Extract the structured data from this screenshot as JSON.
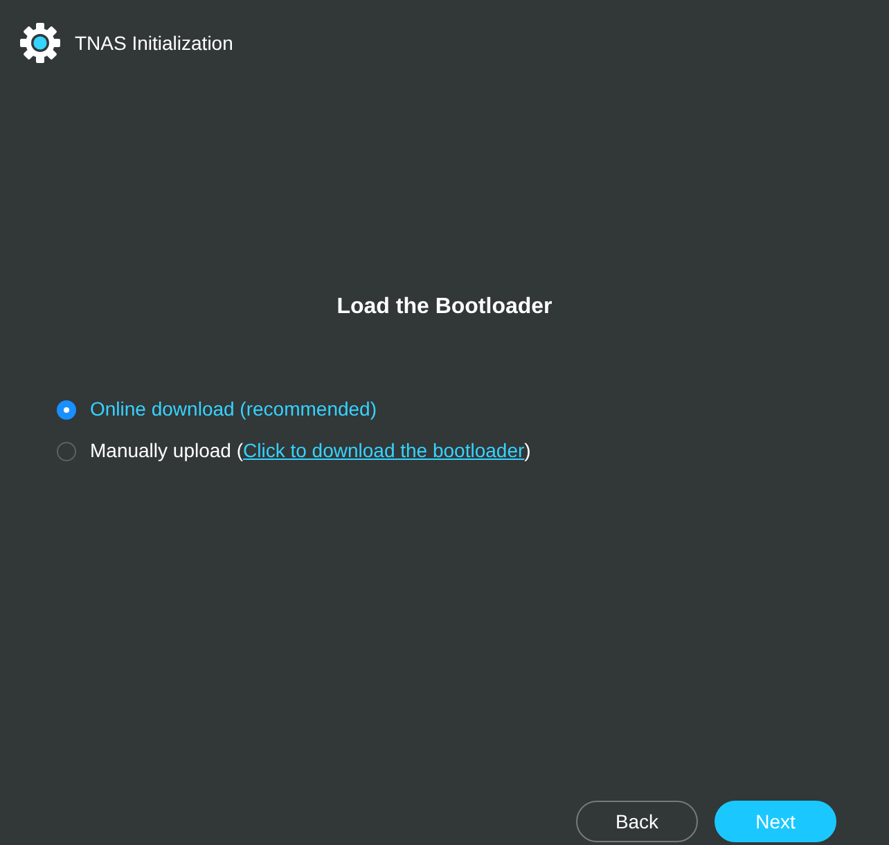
{
  "window": {
    "title": "TNAS Initialization"
  },
  "heading": "Load the Bootloader",
  "options": [
    {
      "kind": "plain",
      "label": "Online download (recommended)",
      "selected": true
    },
    {
      "kind": "link",
      "label_before": "Manually upload (",
      "link": "Click to download the bootloader",
      "label_after": ")",
      "selected": false
    }
  ],
  "buttons": [
    {
      "kind": "outline",
      "label": "Back"
    },
    {
      "kind": "primary",
      "label": "Next"
    }
  ]
}
